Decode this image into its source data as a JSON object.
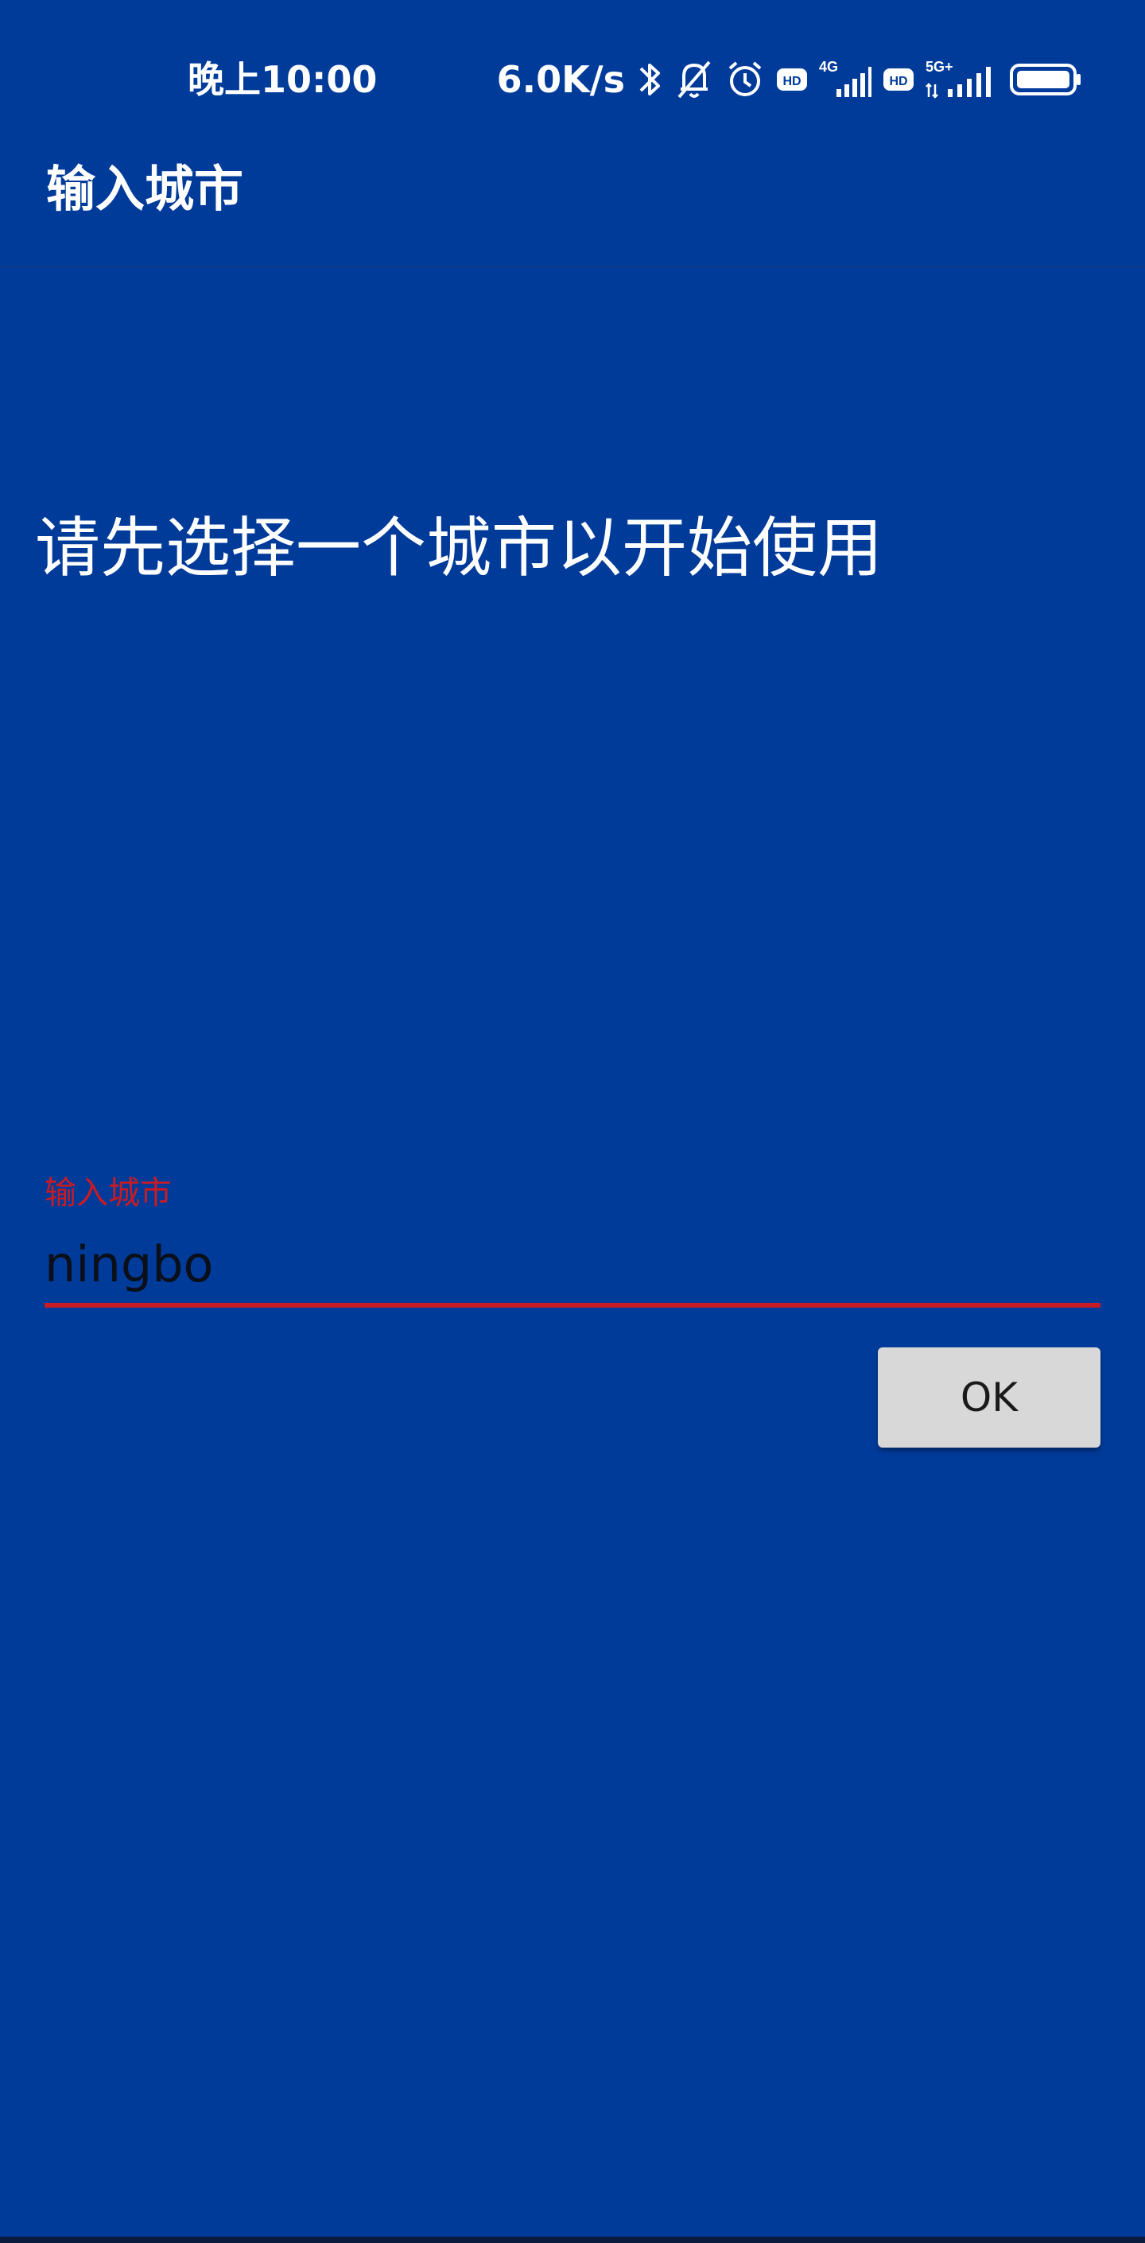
{
  "status_bar": {
    "time": "晚上10:00",
    "net_speed": "6.0K/s",
    "icons": [
      "bluetooth-icon",
      "mute-bell-icon",
      "alarm-icon",
      "hd-icon",
      "4g-signal-icon",
      "hd-icon",
      "5g-signal-icon",
      "battery-icon"
    ],
    "badge_hd": "HD",
    "badge_4g": "4G",
    "badge_5g": "5G+"
  },
  "toolbar": {
    "title": "输入城市"
  },
  "main": {
    "intro": "请先选择一个城市以开始使用",
    "city_field": {
      "label": "输入城市",
      "value": "ningbo"
    },
    "ok_button": "OK"
  },
  "colors": {
    "background": "#003b9a",
    "accent_error": "#c81b24",
    "button_bg": "#d8d8d8"
  }
}
